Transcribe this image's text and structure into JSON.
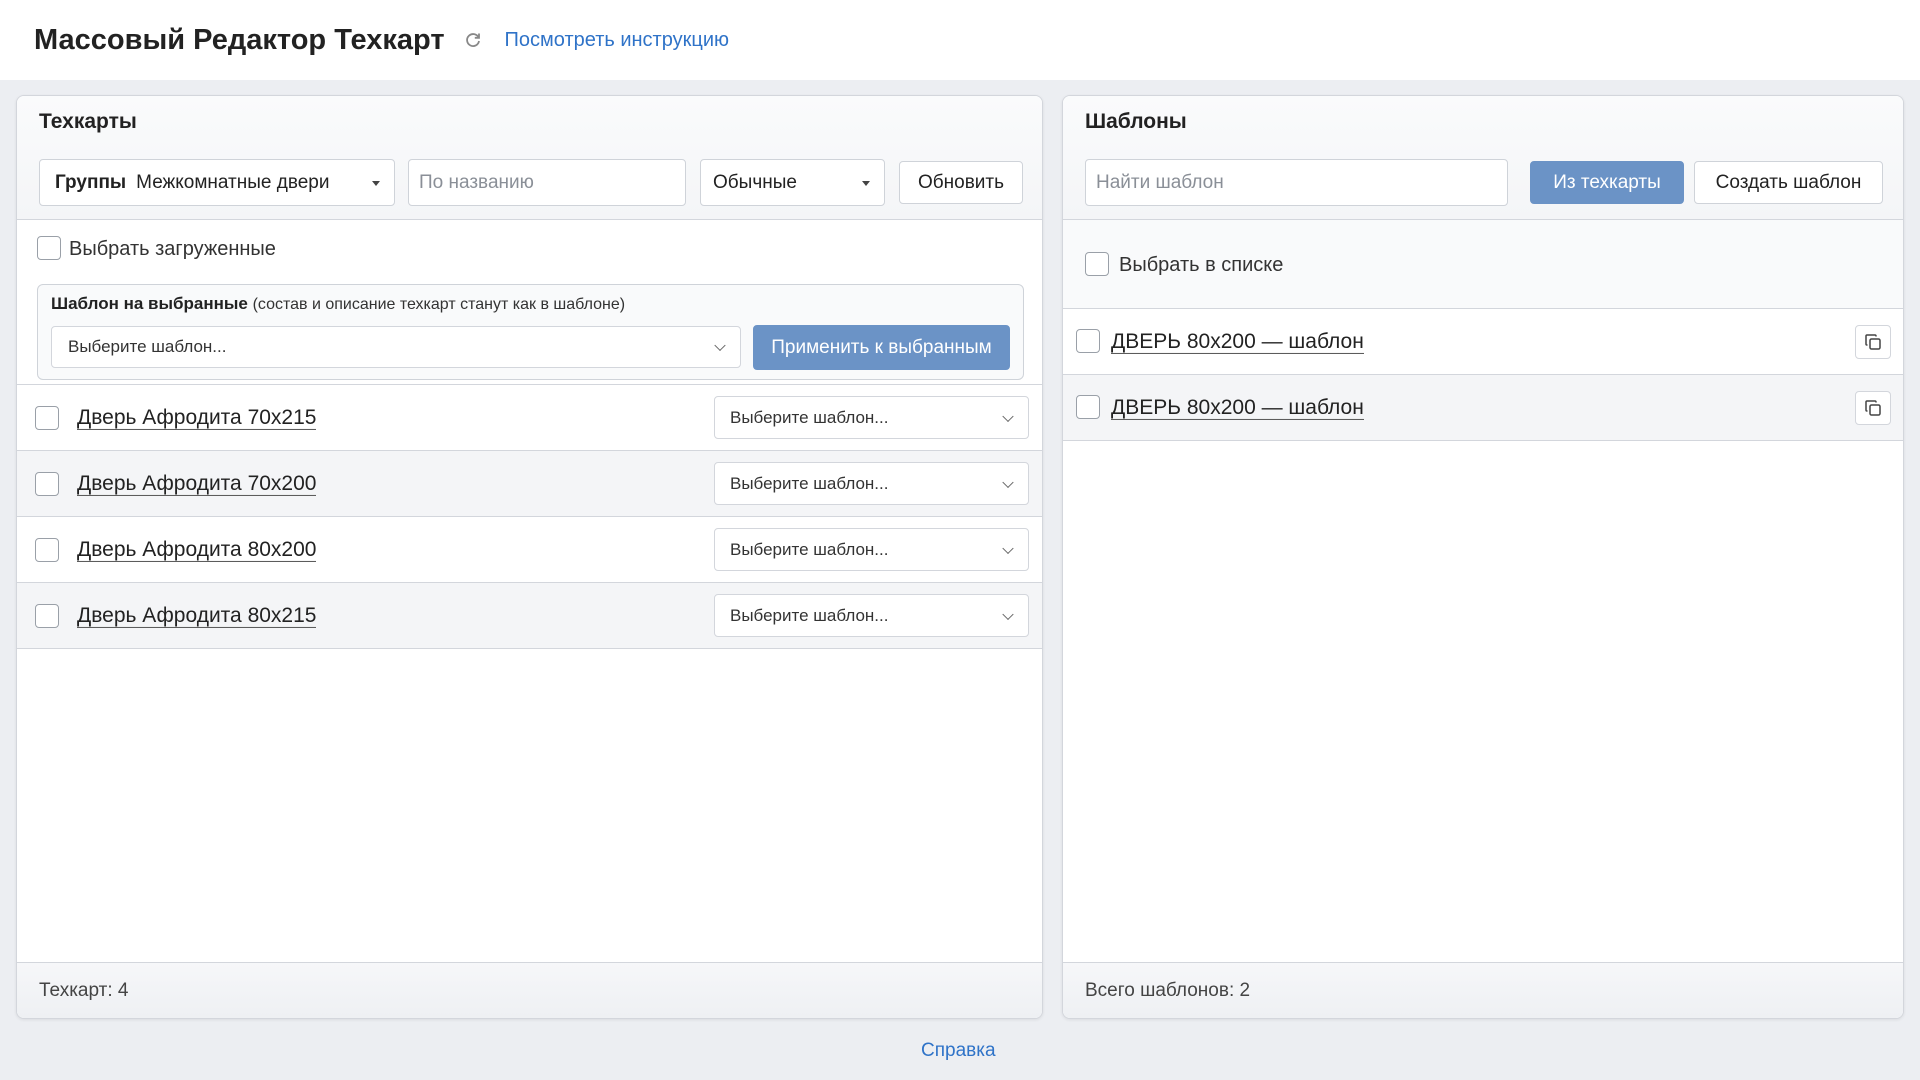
{
  "header": {
    "title": "Массовый Редактор Техкарт",
    "instructions_link": "Посмотреть инструкцию",
    "refresh_icon": "refresh-icon"
  },
  "left_panel": {
    "title": "Техкарты",
    "groups_label": "Группы",
    "groups_value": "Межкомнатные двери",
    "name_placeholder": "По названию",
    "type_value": "Обычные",
    "refresh_button": "Обновить",
    "select_loaded": "Выбрать загруженные",
    "bulk_template_title": "Шаблон на выбранные",
    "bulk_template_note": "(состав и описание техкарт станут как в шаблоне)",
    "bulk_template_placeholder": "Выберите шаблон...",
    "apply_button": "Применить к выбранным",
    "rows": [
      {
        "name": "Дверь Афродита 70х215",
        "template": "Выберите шаблон..."
      },
      {
        "name": "Дверь Афродита 70х200",
        "template": "Выберите шаблон..."
      },
      {
        "name": "Дверь Афродита 80х200",
        "template": "Выберите шаблон..."
      },
      {
        "name": "Дверь Афродита 80х215",
        "template": "Выберите шаблон..."
      }
    ],
    "footer": "Техкарт: 4"
  },
  "right_panel": {
    "title": "Шаблоны",
    "search_placeholder": "Найти шаблон",
    "from_techcard_button": "Из техкарты",
    "create_button": "Создать шаблон",
    "select_in_list": "Выбрать в списке",
    "rows": [
      {
        "name": "ДВЕРЬ 80х200 — шаблон"
      },
      {
        "name": "ДВЕРЬ 80х200 — шаблон"
      }
    ],
    "footer": "Всего шаблонов: 2"
  },
  "footer": {
    "help_link": "Справка"
  },
  "colors": {
    "accent": "#2f73c8",
    "primary_button": "#6b93c6",
    "background": "#eceef2"
  }
}
